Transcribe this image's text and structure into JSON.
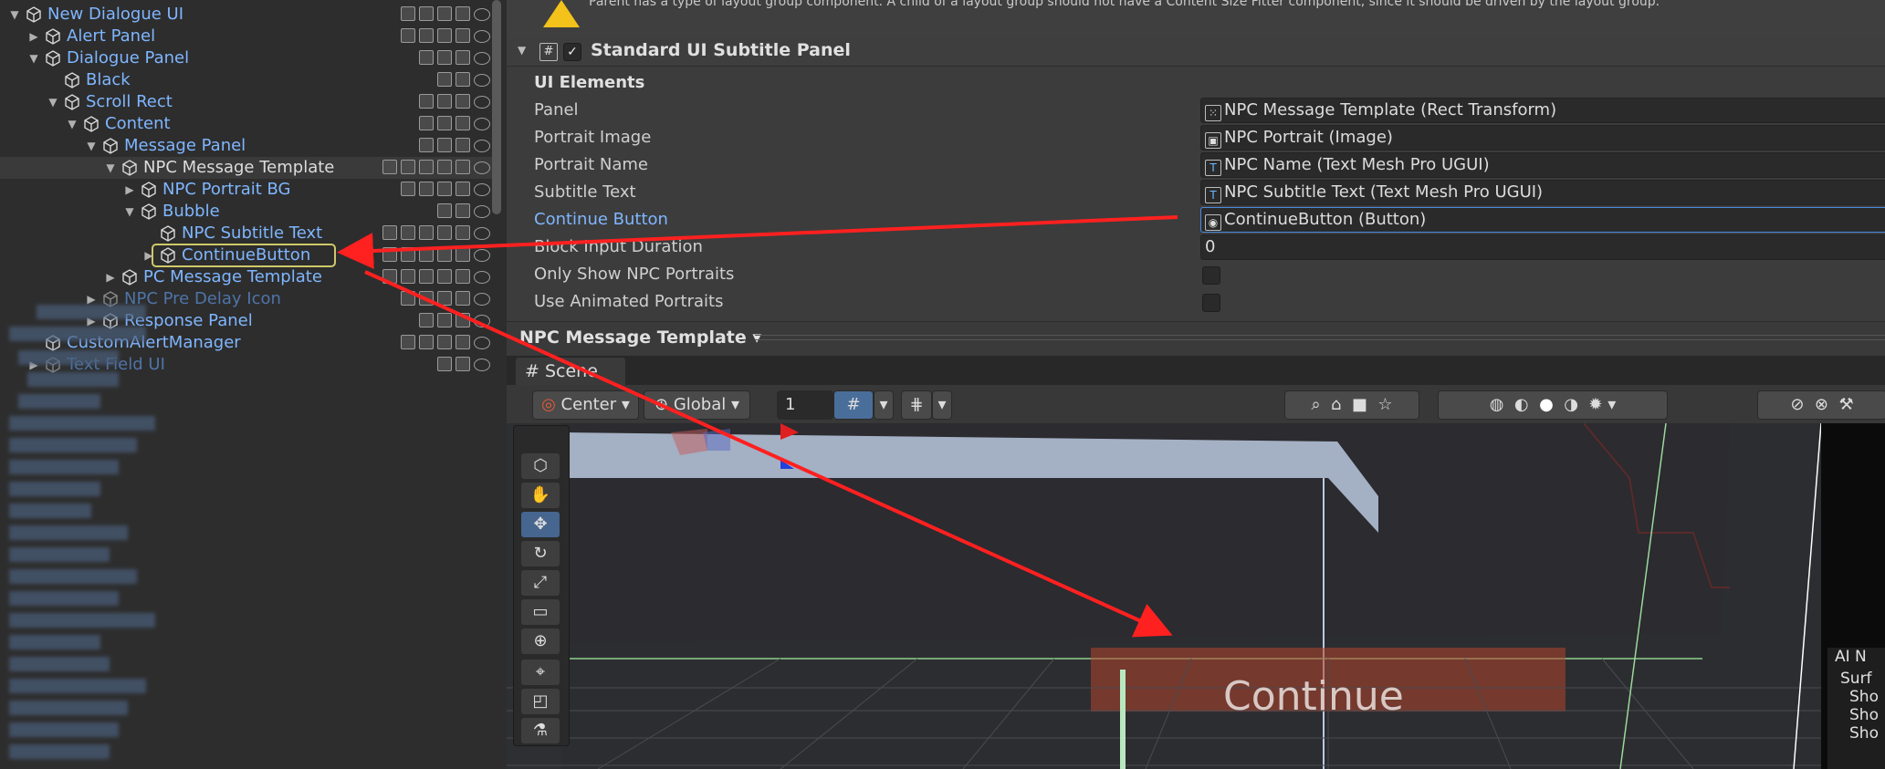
{
  "hierarchy": {
    "rows": [
      {
        "label": "New Dialogue UI",
        "indent": 0,
        "arrow": "▼",
        "style": "blue",
        "icons": 4
      },
      {
        "label": "Alert Panel",
        "indent": 1,
        "arrow": "▶",
        "style": "blue",
        "icons": 4
      },
      {
        "label": "Dialogue Panel",
        "indent": 1,
        "arrow": "▼",
        "style": "blue",
        "icons": 3
      },
      {
        "label": "Black",
        "indent": 2,
        "arrow": "",
        "style": "blue",
        "icons": 2
      },
      {
        "label": "Scroll Rect",
        "indent": 2,
        "arrow": "▼",
        "style": "blue",
        "icons": 3
      },
      {
        "label": "Content",
        "indent": 3,
        "arrow": "▼",
        "style": "blue",
        "icons": 3
      },
      {
        "label": "Message Panel",
        "indent": 4,
        "arrow": "▼",
        "style": "blue",
        "icons": 3
      },
      {
        "label": "NPC Message Template",
        "indent": 5,
        "arrow": "▼",
        "style": "white",
        "icons": 5,
        "selected": true
      },
      {
        "label": "NPC Portrait BG",
        "indent": 6,
        "arrow": "▶",
        "style": "blue",
        "icons": 4
      },
      {
        "label": "Bubble",
        "indent": 6,
        "arrow": "▼",
        "style": "blue",
        "icons": 2
      },
      {
        "label": "NPC Subtitle Text",
        "indent": 7,
        "arrow": "",
        "style": "blue",
        "icons": 5
      },
      {
        "label": "ContinueButton",
        "indent": 7,
        "arrow": "▶",
        "style": "blue",
        "icons": 5,
        "boxed": true
      },
      {
        "label": "PC Message Template",
        "indent": 5,
        "arrow": "▶",
        "style": "blue",
        "icons": 5
      },
      {
        "label": "NPC Pre Delay Icon",
        "indent": 4,
        "arrow": "▶",
        "style": "dim",
        "icons": 4
      },
      {
        "label": "Response Panel",
        "indent": 4,
        "arrow": "▶",
        "style": "blue",
        "icons": 3
      },
      {
        "label": "CustomAlertManager",
        "indent": 1,
        "arrow": "",
        "style": "blue",
        "icons": 4
      },
      {
        "label": "Text Field UI",
        "indent": 1,
        "arrow": "▶",
        "style": "dim",
        "icons": 2
      }
    ]
  },
  "inspector": {
    "warning_text": "Parent has a type of layout group component. A child of a layout group should not have a Content Size Fitter component, since it should be driven by the layout group.",
    "component_title": "Standard UI Subtitle Panel",
    "section_header": "UI Elements",
    "props": [
      {
        "label": "Panel",
        "value": "NPC Message Template (Rect Transform)",
        "icon": "rect-transform-icon"
      },
      {
        "label": "Portrait Image",
        "value": "NPC Portrait (Image)",
        "icon": "image-icon"
      },
      {
        "label": "Portrait Name",
        "value": "NPC Name (Text Mesh Pro UGUI)",
        "icon": "text-icon"
      },
      {
        "label": "Subtitle Text",
        "value": "NPC Subtitle Text (Text Mesh Pro UGUI)",
        "icon": "text-icon"
      },
      {
        "label": "Continue Button",
        "value": "ContinueButton (Button)",
        "icon": "button-icon",
        "highlight": true
      },
      {
        "label": "Block Input Duration",
        "value": "0",
        "icon": ""
      }
    ],
    "checkbox_props": [
      {
        "label": "Only Show NPC Portraits"
      },
      {
        "label": "Use Animated Portraits"
      }
    ],
    "footer_title": "NPC Message Template ▾"
  },
  "scene": {
    "tab_label": "Scene",
    "pivot_label": "Center",
    "space_label": "Global",
    "grid_value": "1",
    "continue_text": "Continue",
    "ai_nav_label": "AI N",
    "ai_nav_sub": "Surf",
    "ai_nav_items": [
      "Sho",
      "Sho",
      "Sho"
    ]
  },
  "colors": {
    "accent": "#7fb6ff",
    "warning": "#f3c21b",
    "arrow": "#ff2020"
  }
}
